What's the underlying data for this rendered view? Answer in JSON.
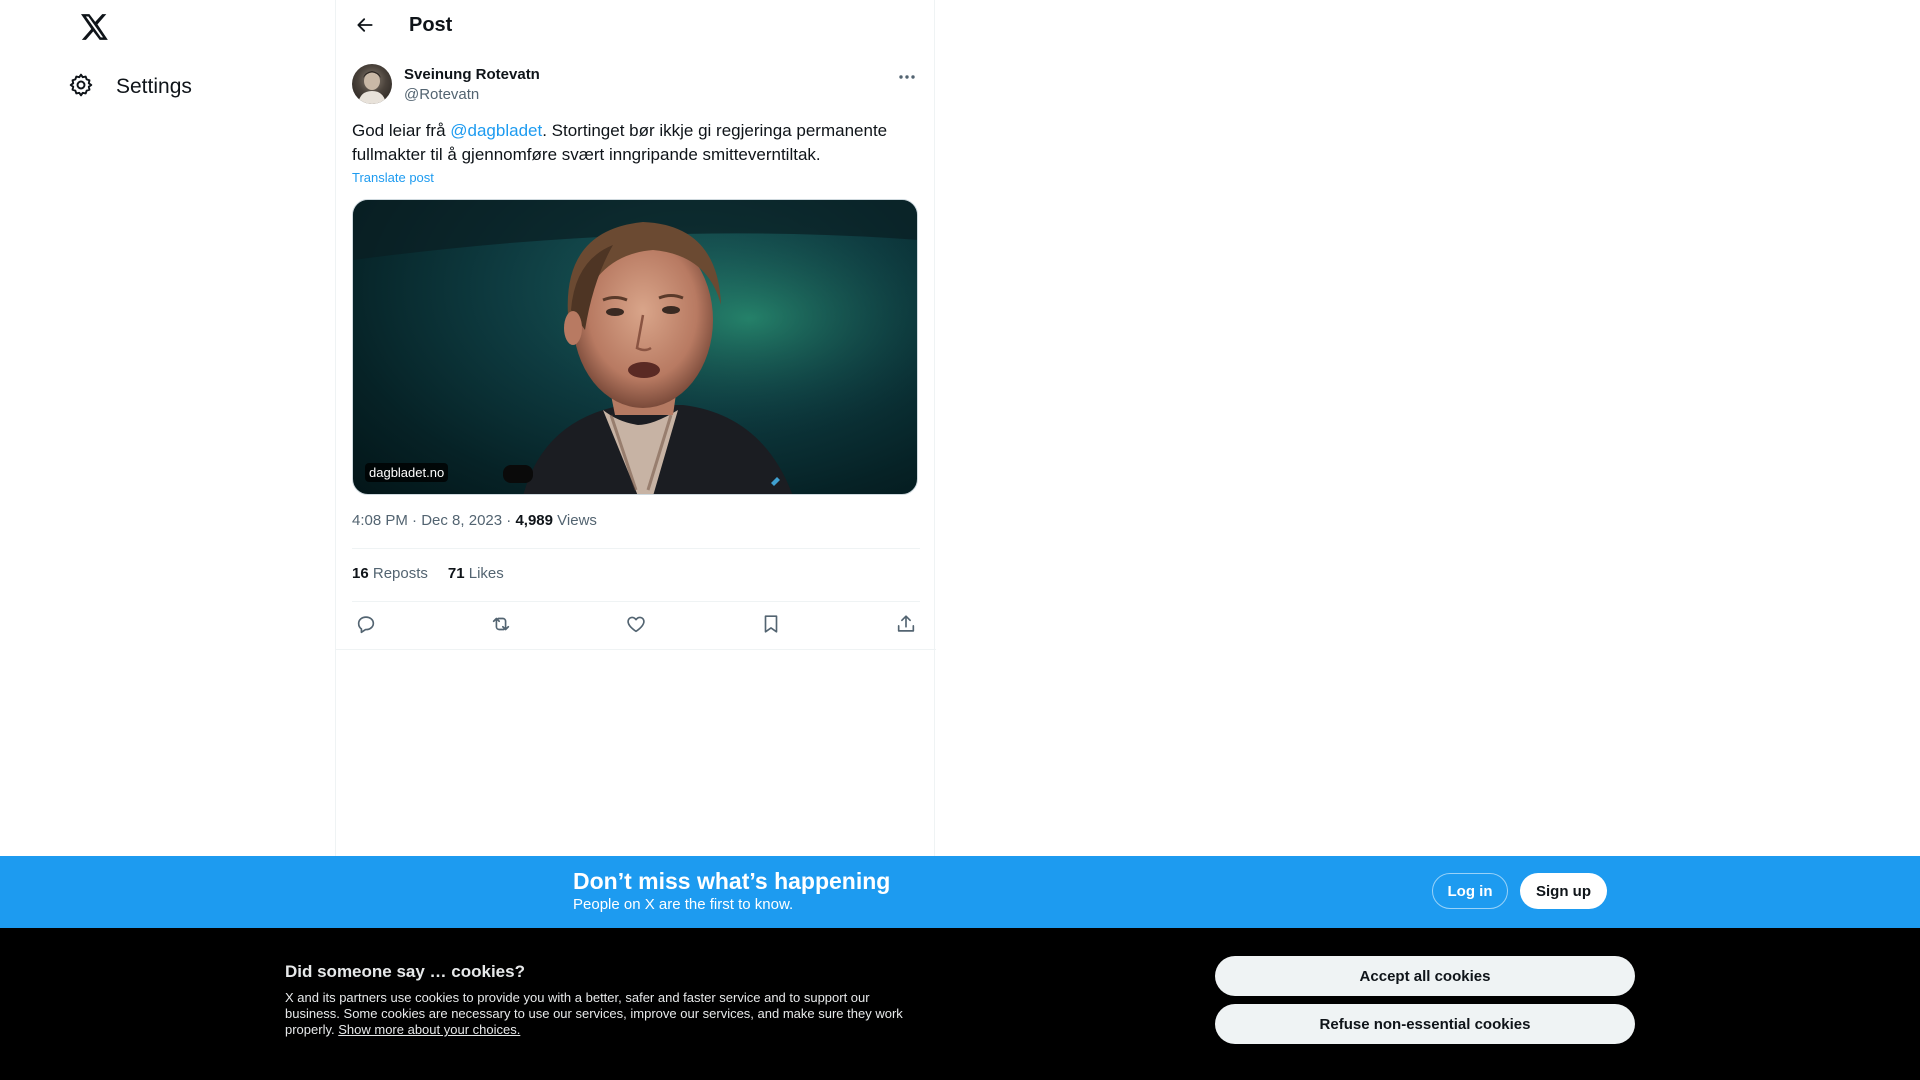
{
  "nav": {
    "logo_icon": "x-logo-icon",
    "settings_label": "Settings",
    "settings_icon": "gear-icon"
  },
  "header": {
    "title": "Post",
    "back_icon": "arrow-left-icon"
  },
  "post": {
    "author_name": "Sveinung Rotevatn",
    "author_handle": "@Rotevatn",
    "text_before": "God leiar frå ",
    "mention": "@dagbladet",
    "text_after": ". Stortinget bør ikkje gi regjeringa permanente fullmakter til å gjennomføre svært inngripande smitteverntiltak.",
    "translate_label": "Translate post",
    "media_source": "dagbladet.no",
    "time": "4:08 PM",
    "date": "Dec 8, 2023",
    "views_count": "4,989",
    "views_label": "Views",
    "reposts_count": "16",
    "reposts_label": "Reposts",
    "likes_count": "71",
    "likes_label": "Likes"
  },
  "banner": {
    "title": "Don’t miss what’s happening",
    "subtitle": "People on X are the first to know.",
    "login_label": "Log in",
    "signup_label": "Sign up"
  },
  "cookies": {
    "title": "Did someone say … cookies?",
    "body": "X and its partners use cookies to provide you with a better, safer and faster service and to support our business. Some cookies are necessary to use our services, improve our services, and make sure they work properly. ",
    "link": "Show more about your choices.",
    "accept_label": "Accept all cookies",
    "refuse_label": "Refuse non-essential cookies"
  },
  "colors": {
    "accent": "#1d9bf0",
    "text": "#0f1419",
    "muted": "#536471",
    "cookie_bg": "#000000"
  }
}
